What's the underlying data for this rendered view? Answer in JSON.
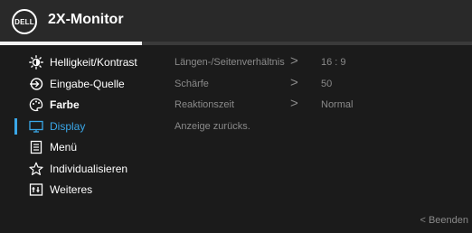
{
  "header": {
    "logo_text": "DELL",
    "title": "2X-Monitor",
    "progress_fraction": 0.3
  },
  "menu": {
    "items": [
      {
        "label": "Helligkeit/Kontrast",
        "icon": "brightness-icon"
      },
      {
        "label": "Eingabe-Quelle",
        "icon": "input-source-icon"
      },
      {
        "label": "Farbe",
        "icon": "color-palette-icon"
      },
      {
        "label": "Display",
        "icon": "display-icon"
      },
      {
        "label": "Menü",
        "icon": "menu-document-icon"
      },
      {
        "label": "Individualisieren",
        "icon": "star-icon"
      },
      {
        "label": "Weiteres",
        "icon": "others-icon"
      }
    ],
    "selected_index": 3,
    "accent_color": "#3aa7e8"
  },
  "detail": {
    "rows": [
      {
        "label": "Längen-/Seitenverhältnis",
        "arrow": ">",
        "value": "16 : 9"
      },
      {
        "label": "Schärfe",
        "arrow": ">",
        "value": "50"
      },
      {
        "label": "Reaktionszeit",
        "arrow": ">",
        "value": "Normal"
      },
      {
        "label": "Anzeige zurücks."
      }
    ]
  },
  "footer": {
    "exit_label": "< Beenden"
  }
}
